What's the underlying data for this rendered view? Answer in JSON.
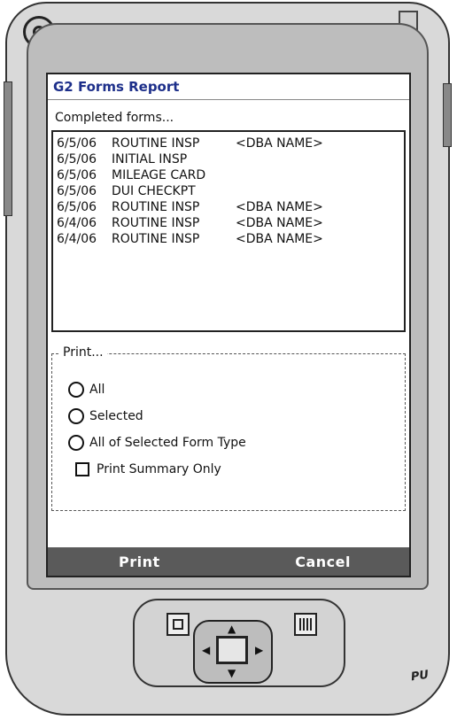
{
  "window": {
    "title": "G2 Forms Report"
  },
  "section_title": "Completed forms...",
  "forms": [
    {
      "date": "6/5/06",
      "type": "ROUTINE INSP",
      "name": "<DBA NAME>"
    },
    {
      "date": "6/5/06",
      "type": "INITIAL INSP",
      "name": ""
    },
    {
      "date": "6/5/06",
      "type": "MILEAGE CARD",
      "name": ""
    },
    {
      "date": "6/5/06",
      "type": "DUI CHECKPT",
      "name": ""
    },
    {
      "date": "6/5/06",
      "type": "ROUTINE INSP",
      "name": "<DBA NAME>"
    },
    {
      "date": "6/4/06",
      "type": "ROUTINE INSP",
      "name": "<DBA NAME>"
    },
    {
      "date": "6/4/06",
      "type": "ROUTINE INSP",
      "name": "<DBA NAME>"
    }
  ],
  "print_group": {
    "legend": "Print...",
    "options": [
      {
        "label": "All"
      },
      {
        "label": "Selected"
      },
      {
        "label": "All of Selected Form Type"
      }
    ],
    "summary_checkbox": "Print Summary Only"
  },
  "softkeys": {
    "left": "Print",
    "right": "Cancel"
  },
  "hardware": {
    "logo": "PU"
  },
  "colors": {
    "title": "#1d2f8a",
    "softkey_bar": "#5a5a5a",
    "screen_bg": "#ffffff"
  },
  "icons": [
    "power-icon",
    "speaker-grille",
    "calendar-key-icon",
    "contacts-key-icon",
    "dpad"
  ]
}
